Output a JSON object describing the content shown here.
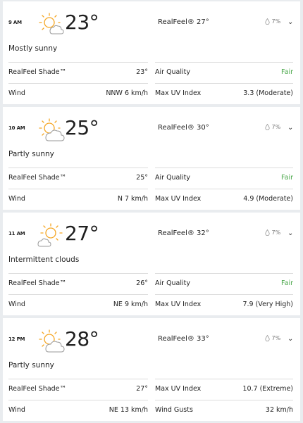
{
  "hours": [
    {
      "time": "9 AM",
      "temp": "23°",
      "icon": "mostly-sunny-icon",
      "realfeel": "RealFeel® 27°",
      "precip": "7%",
      "condition": "Mostly sunny",
      "details": [
        {
          "left_label": "RealFeel Shade™",
          "left_value": "23°",
          "right_label": "Air Quality",
          "right_value": "Fair"
        },
        {
          "left_label": "Wind",
          "left_value": "NNW 6 km/h",
          "right_label": "Max UV Index",
          "right_value": "3.3 (Moderate)"
        }
      ]
    },
    {
      "time": "10 AM",
      "temp": "25°",
      "icon": "partly-sunny-icon",
      "realfeel": "RealFeel® 30°",
      "precip": "7%",
      "condition": "Partly sunny",
      "details": [
        {
          "left_label": "RealFeel Shade™",
          "left_value": "25°",
          "right_label": "Air Quality",
          "right_value": "Fair"
        },
        {
          "left_label": "Wind",
          "left_value": "N 7 km/h",
          "right_label": "Max UV Index",
          "right_value": "4.9 (Moderate)"
        }
      ]
    },
    {
      "time": "11 AM",
      "temp": "27°",
      "icon": "intermittent-clouds-icon",
      "realfeel": "RealFeel® 32°",
      "precip": "7%",
      "condition": "Intermittent clouds",
      "details": [
        {
          "left_label": "RealFeel Shade™",
          "left_value": "26°",
          "right_label": "Air Quality",
          "right_value": "Fair"
        },
        {
          "left_label": "Wind",
          "left_value": "NE 9 km/h",
          "right_label": "Max UV Index",
          "right_value": "7.9 (Very High)"
        }
      ]
    },
    {
      "time": "12 PM",
      "temp": "28°",
      "icon": "partly-sunny-icon",
      "realfeel": "RealFeel® 33°",
      "precip": "7%",
      "condition": "Partly sunny",
      "details": [
        {
          "left_label": "RealFeel Shade™",
          "left_value": "27°",
          "right_label": "Max UV Index",
          "right_value": "10.7 (Extreme)"
        },
        {
          "left_label": "Wind",
          "left_value": "NE 13 km/h",
          "right_label": "Wind Gusts",
          "right_value": "32 km/h"
        }
      ]
    }
  ],
  "colors": {
    "sun": "#f5a623",
    "cloud_outline": "#9a9a9a",
    "good": "#4ba84b",
    "separator": "#dcdcdc",
    "background": "#e9ecef"
  }
}
